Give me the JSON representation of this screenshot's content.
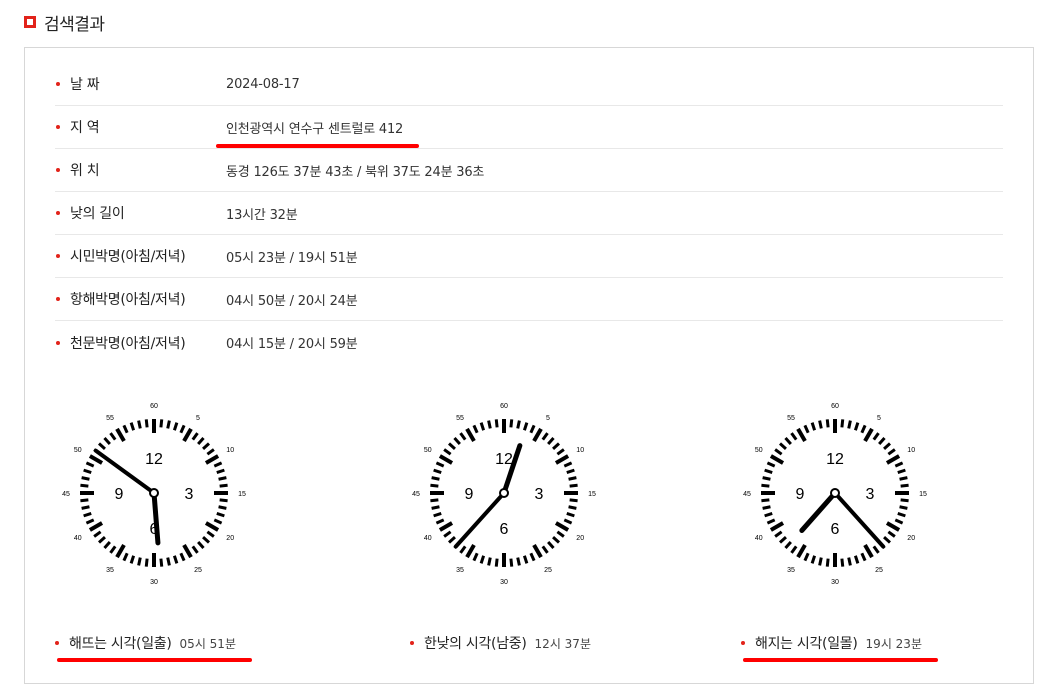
{
  "header": {
    "title": "검색결과"
  },
  "info": [
    {
      "label": "날 짜",
      "value": "2024-08-17"
    },
    {
      "label": "지 역",
      "value": "인천광역시 연수구 센트럴로 412"
    },
    {
      "label": "위 치",
      "value": "동경 126도 37분 43초 / 북위 37도 24분 36초"
    },
    {
      "label": "낮의 길이",
      "value": "13시간 32분"
    },
    {
      "label": "시민박명(아침/저녁)",
      "value": "05시 23분 / 19시 51분"
    },
    {
      "label": "항해박명(아침/저녁)",
      "value": "04시 50분 / 20시 24분"
    },
    {
      "label": "천문박명(아침/저녁)",
      "value": "04시 15분 / 20시 59분"
    }
  ],
  "clock_faces": {
    "hour_numerals": [
      "12",
      "3",
      "6",
      "9"
    ],
    "minute_labels": [
      "60",
      "5",
      "10",
      "15",
      "20",
      "25",
      "30",
      "35",
      "40",
      "45",
      "50",
      "55"
    ]
  },
  "clocks": [
    {
      "label": "해뜨는 시각(일출)",
      "time": "05시 51분",
      "hour": 5,
      "minute": 51
    },
    {
      "label": "한낮의 시각(남중)",
      "time": "12시 37분",
      "hour": 12,
      "minute": 37
    },
    {
      "label": "해지는 시각(일몰)",
      "time": "19시 23분",
      "hour": 19,
      "minute": 23
    }
  ],
  "colors": {
    "accent": "#e2231a",
    "highlight": "#ff0000"
  }
}
